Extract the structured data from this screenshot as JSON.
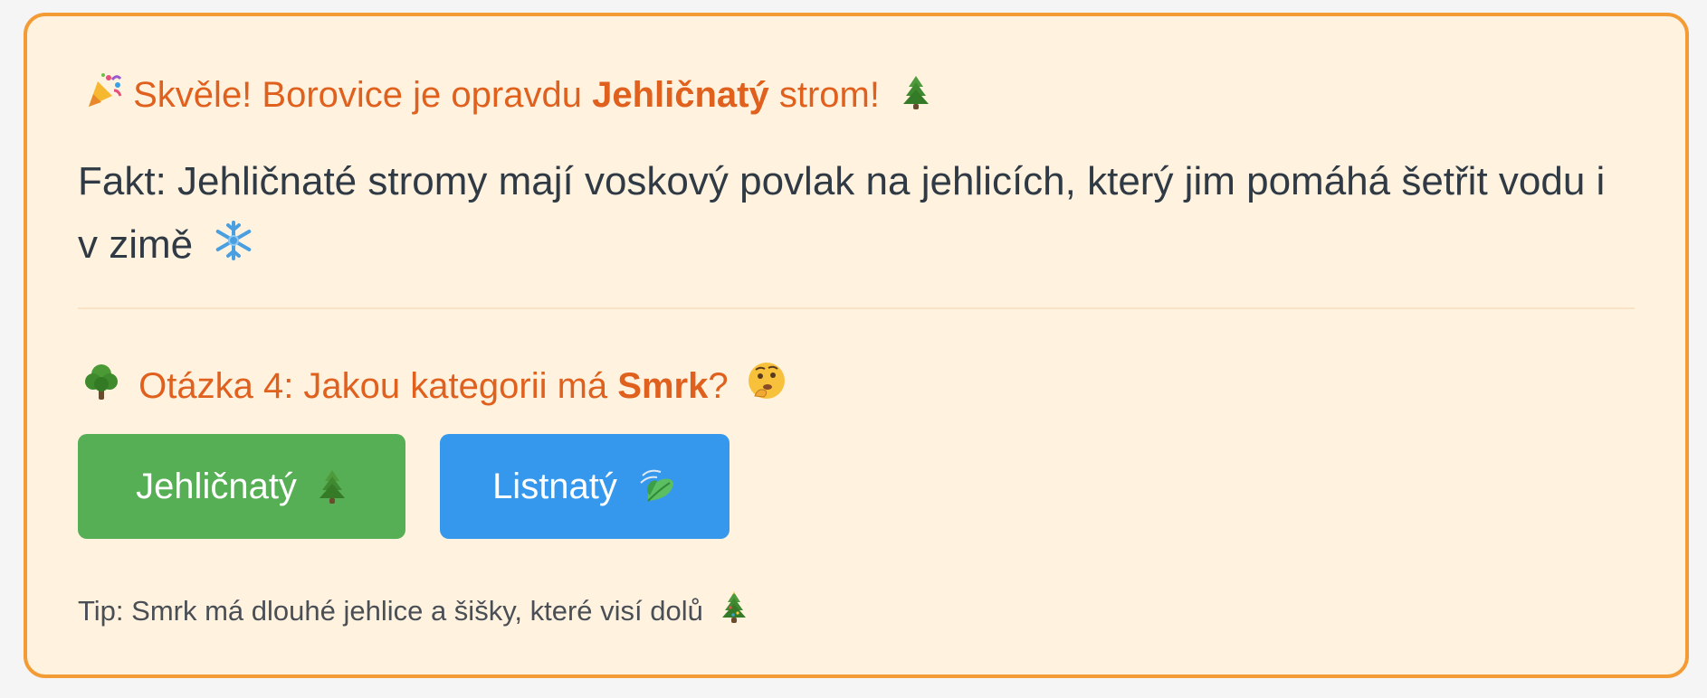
{
  "feedback": {
    "prefix": "Skvěle! Borovice je opravdu",
    "category": "Jehličnatý",
    "suffix": "strom!",
    "icons": [
      "party-popper-icon",
      "evergreen-tree-icon"
    ]
  },
  "fact": {
    "text": "Fakt: Jehličnaté stromy mají voskový povlak na jehlicích, který jim pomáhá šetřit vodu i v zimě",
    "icon": "snowflake-icon"
  },
  "question": {
    "prefix": "Otázka 4: Jakou kategorii má",
    "tree": "Smrk",
    "suffix": "?",
    "icons": [
      "deciduous-tree-icon",
      "thinking-face-icon"
    ]
  },
  "answers": [
    {
      "label": "Jehličnatý",
      "icon": "evergreen-tree-icon",
      "color": "#56af55"
    },
    {
      "label": "Listnatý",
      "icon": "leaf-fluttering-icon",
      "color": "#3598ec"
    }
  ],
  "tip": {
    "text": "Tip: Smrk má dlouhé jehlice a šišky, které visí dolů",
    "icon": "christmas-tree-icon"
  },
  "colors": {
    "card_background": "#fff3e0",
    "card_border": "#f39c35",
    "accent_text": "#e0601e",
    "body_text": "#303a44"
  }
}
